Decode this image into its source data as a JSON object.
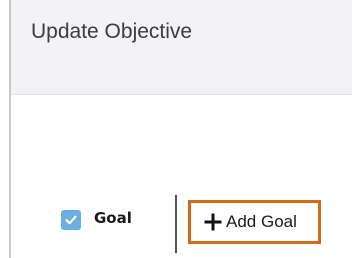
{
  "header": {
    "title": "Update Objective"
  },
  "goal_filter": {
    "label": "Goal",
    "checked": true,
    "check_icon": "checkmark-icon",
    "accent_color": "#6aaee2"
  },
  "add_goal": {
    "label": "Add Goal",
    "icon": "plus-icon",
    "highlight_color": "#d06b17"
  }
}
